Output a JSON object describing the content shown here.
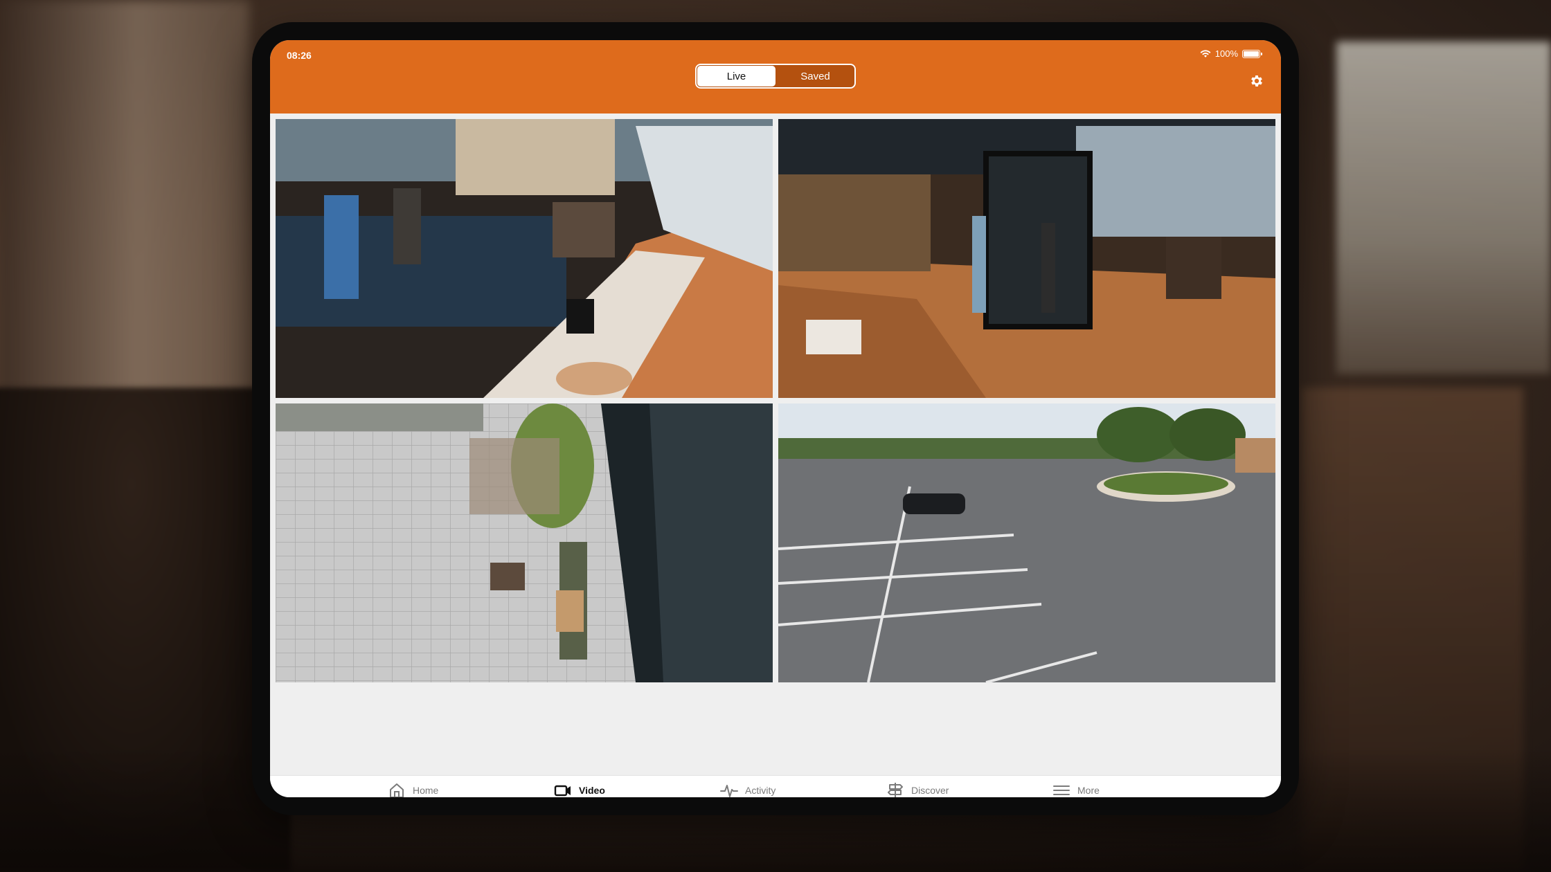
{
  "status": {
    "time": "08:26",
    "battery": "100%"
  },
  "header": {
    "segments": [
      {
        "label": "Live",
        "active": true
      },
      {
        "label": "Saved",
        "active": false
      }
    ],
    "accent_color": "#de6b1c"
  },
  "cameras": [
    {
      "scene": "coffee-bar"
    },
    {
      "scene": "cafe-entrance"
    },
    {
      "scene": "outdoor-patio"
    },
    {
      "scene": "parking-lot"
    }
  ],
  "tabbar": {
    "items": [
      {
        "label": "Home",
        "icon": "home-icon",
        "active": false
      },
      {
        "label": "Video",
        "icon": "video-camera-icon",
        "active": true
      },
      {
        "label": "Activity",
        "icon": "activity-pulse-icon",
        "active": false
      },
      {
        "label": "Discover",
        "icon": "signpost-icon",
        "active": false
      },
      {
        "label": "More",
        "icon": "menu-lines-icon",
        "active": false
      }
    ]
  }
}
